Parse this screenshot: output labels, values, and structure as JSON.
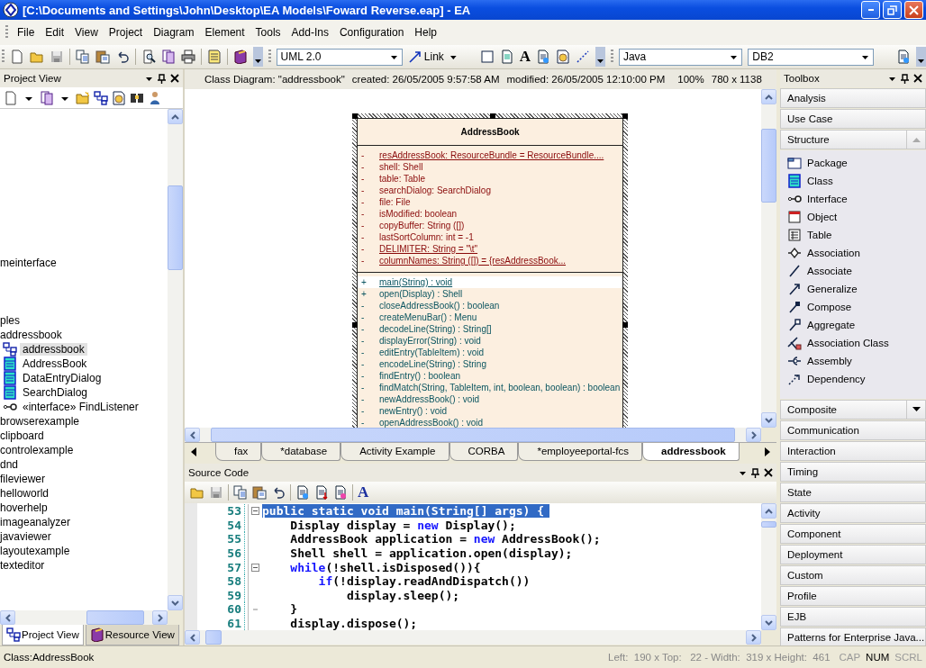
{
  "window": {
    "title": "[C:\\Documents and Settings\\John\\Desktop\\EA Models\\Foward Reverse.eap] - EA"
  },
  "menu": [
    "File",
    "Edit",
    "View",
    "Project",
    "Diagram",
    "Element",
    "Tools",
    "Add-Ins",
    "Configuration",
    "Help"
  ],
  "toolbar": {
    "profile": "UML 2.0",
    "link": "Link",
    "font_glyph": "A",
    "language": "Java",
    "database": "DB2"
  },
  "project_view": {
    "title": "Project View",
    "tree": [
      {
        "label": "meinterface",
        "kind": "package",
        "selected": false
      },
      {
        "label": "ples",
        "kind": "package",
        "selected": false,
        "children": [
          {
            "label": "addressbook",
            "kind": "package",
            "selected": false,
            "children": [
              {
                "label": "addressbook",
                "kind": "diagram",
                "selected": true
              },
              {
                "label": "AddressBook",
                "kind": "class",
                "selected": false
              },
              {
                "label": "DataEntryDialog",
                "kind": "class",
                "selected": false
              },
              {
                "label": "SearchDialog",
                "kind": "class",
                "selected": false
              },
              {
                "label": "«interface» FindListener",
                "kind": "interface",
                "selected": false
              }
            ]
          },
          {
            "label": "browserexample",
            "kind": "package",
            "selected": false
          },
          {
            "label": "clipboard",
            "kind": "package",
            "selected": false
          },
          {
            "label": "controlexample",
            "kind": "package",
            "selected": false
          },
          {
            "label": "dnd",
            "kind": "package",
            "selected": false
          },
          {
            "label": "fileviewer",
            "kind": "package",
            "selected": false
          },
          {
            "label": "helloworld",
            "kind": "package",
            "selected": false
          },
          {
            "label": "hoverhelp",
            "kind": "package",
            "selected": false
          },
          {
            "label": "imageanalyzer",
            "kind": "package",
            "selected": false
          },
          {
            "label": "javaviewer",
            "kind": "package",
            "selected": false
          },
          {
            "label": "layoutexample",
            "kind": "package",
            "selected": false
          },
          {
            "label": "texteditor",
            "kind": "package",
            "selected": false
          }
        ]
      }
    ],
    "tabs": [
      {
        "label": "Project View",
        "selected": true
      },
      {
        "label": "Resource View",
        "selected": false
      }
    ]
  },
  "diagram": {
    "title": "Class Diagram: \"addressbook\"",
    "created": "created: 26/05/2005 9:57:58 AM",
    "modified": "modified: 26/05/2005 12:10:00 PM",
    "zoom": "100%",
    "size": "780 x 1138",
    "class": {
      "name": "AddressBook",
      "attributes": [
        {
          "visibility": "-",
          "text": "resAddressBook:  ResourceBundle = ResourceBundle....",
          "static": true
        },
        {
          "visibility": "-",
          "text": "shell:  Shell",
          "static": false
        },
        {
          "visibility": "-",
          "text": "table:  Table",
          "static": false
        },
        {
          "visibility": "-",
          "text": "searchDialog:  SearchDialog",
          "static": false
        },
        {
          "visibility": "-",
          "text": "file:  File",
          "static": false
        },
        {
          "visibility": "-",
          "text": "isModified:  boolean",
          "static": false
        },
        {
          "visibility": "-",
          "text": "copyBuffer:  String ([])",
          "static": false
        },
        {
          "visibility": "-",
          "text": "lastSortColumn:  int = -1",
          "static": false
        },
        {
          "visibility": "-",
          "text": "DELIMITER:  String = \"\\t\"",
          "static": true
        },
        {
          "visibility": "-",
          "text": "columnNames:  String ([]) = {resAddressBook...",
          "static": true
        }
      ],
      "operations": [
        {
          "visibility": "+",
          "text": "main(String) : void",
          "static": true,
          "selected": true
        },
        {
          "visibility": "+",
          "text": "open(Display) : Shell",
          "static": false,
          "selected": false
        },
        {
          "visibility": "-",
          "text": "closeAddressBook() : boolean",
          "static": false,
          "selected": false
        },
        {
          "visibility": "-",
          "text": "createMenuBar() : Menu",
          "static": false,
          "selected": false
        },
        {
          "visibility": "-",
          "text": "decodeLine(String) : String[]",
          "static": false,
          "selected": false
        },
        {
          "visibility": "-",
          "text": "displayError(String) : void",
          "static": false,
          "selected": false
        },
        {
          "visibility": "-",
          "text": "editEntry(TableItem) : void",
          "static": false,
          "selected": false
        },
        {
          "visibility": "-",
          "text": "encodeLine(String) : String",
          "static": false,
          "selected": false
        },
        {
          "visibility": "-",
          "text": "findEntry() : boolean",
          "static": false,
          "selected": false
        },
        {
          "visibility": "-",
          "text": "findMatch(String, TableItem, int, boolean, boolean) : boolean",
          "static": false,
          "selected": false
        },
        {
          "visibility": "-",
          "text": "newAddressBook() : void",
          "static": false,
          "selected": false
        },
        {
          "visibility": "-",
          "text": "newEntry() : void",
          "static": false,
          "selected": false
        },
        {
          "visibility": "-",
          "text": "openAddressBook() : void",
          "static": false,
          "selected": false
        }
      ]
    }
  },
  "diagram_tabs": [
    {
      "label": "fax",
      "selected": false
    },
    {
      "label": "*database",
      "selected": false
    },
    {
      "label": "Activity Example",
      "selected": false
    },
    {
      "label": "CORBA",
      "selected": false
    },
    {
      "label": "*employeeportal-fcs",
      "selected": false
    },
    {
      "label": "addressbook",
      "selected": true
    }
  ],
  "source_code": {
    "title": "Source Code",
    "font_glyph": "A",
    "lines": [
      {
        "number": "53",
        "fold_box": true,
        "fold_end": false,
        "selected": true,
        "tokens": [
          {
            "text": "public static void main(String[] args) {",
            "kind": "plain"
          }
        ]
      },
      {
        "number": "54",
        "fold_box": false,
        "fold_end": false,
        "selected": false,
        "tokens": [
          {
            "text": "    Display display = ",
            "kind": "plain"
          },
          {
            "text": "new",
            "kind": "keyword"
          },
          {
            "text": " Display();",
            "kind": "plain"
          }
        ]
      },
      {
        "number": "55",
        "fold_box": false,
        "fold_end": false,
        "selected": false,
        "tokens": [
          {
            "text": "    AddressBook application = ",
            "kind": "plain"
          },
          {
            "text": "new",
            "kind": "keyword"
          },
          {
            "text": " AddressBook();",
            "kind": "plain"
          }
        ]
      },
      {
        "number": "56",
        "fold_box": false,
        "fold_end": false,
        "selected": false,
        "tokens": [
          {
            "text": "    Shell shell = application.open(display);",
            "kind": "plain"
          }
        ]
      },
      {
        "number": "57",
        "fold_box": true,
        "fold_end": false,
        "selected": false,
        "tokens": [
          {
            "text": "    while",
            "kind": "keyword"
          },
          {
            "text": "(!shell.isDisposed()){",
            "kind": "plain"
          }
        ]
      },
      {
        "number": "58",
        "fold_box": false,
        "fold_end": false,
        "selected": false,
        "tokens": [
          {
            "text": "        if",
            "kind": "keyword"
          },
          {
            "text": "(!display.readAndDispatch())",
            "kind": "plain"
          }
        ]
      },
      {
        "number": "59",
        "fold_box": false,
        "fold_end": false,
        "selected": false,
        "tokens": [
          {
            "text": "            display.sleep();",
            "kind": "plain"
          }
        ]
      },
      {
        "number": "60",
        "fold_box": false,
        "fold_end": true,
        "selected": false,
        "tokens": [
          {
            "text": "    }",
            "kind": "plain"
          }
        ]
      },
      {
        "number": "61",
        "fold_box": false,
        "fold_end": false,
        "selected": false,
        "tokens": [
          {
            "text": "    display.dispose();",
            "kind": "plain"
          }
        ]
      }
    ]
  },
  "toolbox": {
    "title": "Toolbox",
    "categories": [
      {
        "label": "Analysis",
        "expanded": false,
        "dropdown": false
      },
      {
        "label": "Use Case",
        "expanded": false,
        "dropdown": false
      },
      {
        "label": "Structure",
        "expanded": true,
        "dropdown": false,
        "items": [
          "Package",
          "Class",
          "Interface",
          "Object",
          "Table",
          "Association",
          "Associate",
          "Generalize",
          "Compose",
          "Aggregate",
          "Association Class",
          "Assembly",
          "Dependency"
        ]
      },
      {
        "label": "Composite",
        "expanded": false,
        "dropdown": true
      },
      {
        "label": "Communication",
        "expanded": false,
        "dropdown": false
      },
      {
        "label": "Interaction",
        "expanded": false,
        "dropdown": false
      },
      {
        "label": "Timing",
        "expanded": false,
        "dropdown": false
      },
      {
        "label": "State",
        "expanded": false,
        "dropdown": false
      },
      {
        "label": "Activity",
        "expanded": false,
        "dropdown": false
      },
      {
        "label": "Component",
        "expanded": false,
        "dropdown": false
      },
      {
        "label": "Deployment",
        "expanded": false,
        "dropdown": false
      },
      {
        "label": "Custom",
        "expanded": false,
        "dropdown": false
      },
      {
        "label": "Profile",
        "expanded": false,
        "dropdown": false
      },
      {
        "label": "EJB",
        "expanded": false,
        "dropdown": false
      },
      {
        "label": "Patterns for Enterprise Java...",
        "expanded": false,
        "dropdown": false
      }
    ]
  },
  "status_bar": {
    "element": "Class:AddressBook",
    "position": "Left:  190 x Top:   22 - Width:  319 x Height:  461",
    "keys": [
      {
        "label": "CAP",
        "on": false
      },
      {
        "label": "NUM",
        "on": true
      },
      {
        "label": "SCRL",
        "on": false
      }
    ]
  }
}
